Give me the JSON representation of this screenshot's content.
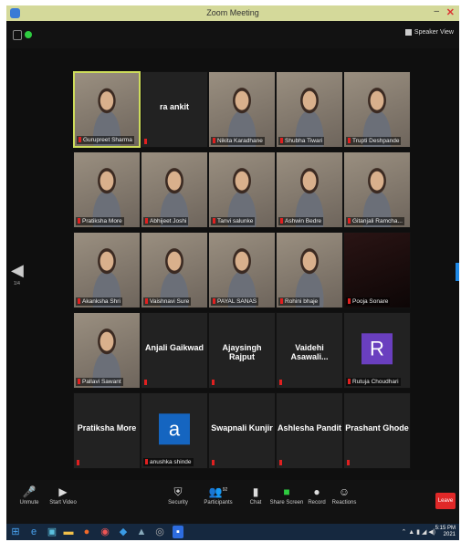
{
  "window": {
    "title": "Zoom Meeting"
  },
  "topbar": {
    "speaker_view_label": "Speaker View"
  },
  "page_indicator": "1/4",
  "participants": [
    [
      {
        "name": "Gurupreet Sharma",
        "kind": "video",
        "active": true
      },
      {
        "name": "",
        "kind": "text",
        "big": "ra ankit"
      },
      {
        "name": "Nikita Karadhane",
        "kind": "video"
      },
      {
        "name": "Shubha Tiwari",
        "kind": "video"
      },
      {
        "name": "Trupti Deshpande",
        "kind": "video"
      }
    ],
    [
      {
        "name": "Pratiksha More",
        "kind": "video"
      },
      {
        "name": "Abhijeet Joshi",
        "kind": "video"
      },
      {
        "name": "Tanvi salunke",
        "kind": "video"
      },
      {
        "name": "Ashwin Bedre",
        "kind": "video"
      },
      {
        "name": "Gitanjali Ramcha...",
        "kind": "video"
      }
    ],
    [
      {
        "name": "Akanksha Shri",
        "kind": "video"
      },
      {
        "name": "Vaishnavi Sure",
        "kind": "video"
      },
      {
        "name": "PAYAL SANAS",
        "kind": "video"
      },
      {
        "name": "Rohini bhaje",
        "kind": "video"
      },
      {
        "name": "Pooja Sonare",
        "kind": "dark"
      }
    ],
    [
      {
        "name": "Pallavi Sawant",
        "kind": "video"
      },
      {
        "name": "",
        "kind": "text",
        "big": "Anjali Gaikwad"
      },
      {
        "name": "",
        "kind": "text",
        "big": "Ajaysingh Rajput"
      },
      {
        "name": "",
        "kind": "text",
        "big": "Vaidehi Asawali..."
      },
      {
        "name": "Rutuja Choudhari",
        "kind": "avatar",
        "letter": "R",
        "color": "#6a3fbf"
      }
    ],
    [
      {
        "name": "",
        "kind": "text",
        "big": "Pratiksha More"
      },
      {
        "name": "anushka shinde",
        "kind": "avatar",
        "letter": "a",
        "color": "#1565c0"
      },
      {
        "name": "",
        "kind": "text",
        "big": "Swapnali Kunjir"
      },
      {
        "name": "",
        "kind": "text",
        "big": "Ashlesha Pandit"
      },
      {
        "name": "",
        "kind": "text",
        "big": "Prashant Ghode"
      }
    ]
  ],
  "toolbar": {
    "unmute": "Unmute",
    "start_video": "Start Video",
    "security": "Security",
    "participants": "Participants",
    "participants_count": "92",
    "chat": "Chat",
    "share_screen": "Share Screen",
    "record": "Record",
    "reactions": "Reactions",
    "end": "Leave"
  },
  "taskbar": {
    "time": "5:15 PM",
    "date": "2021"
  },
  "colors": {
    "active_border": "#cddc5a",
    "mute": "#e02020",
    "share": "#2ecc40",
    "end": "#e02828"
  }
}
